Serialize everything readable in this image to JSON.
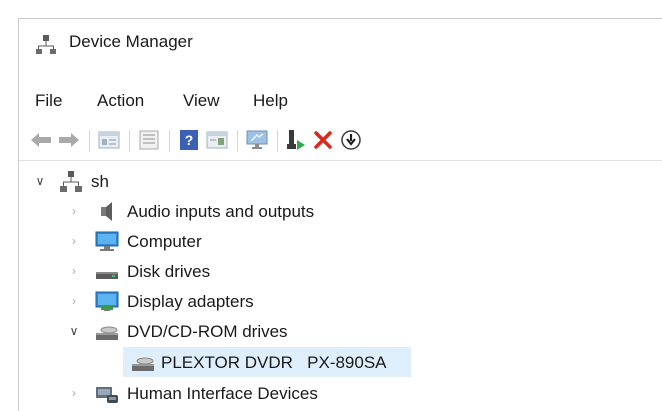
{
  "window": {
    "title": "Device Manager"
  },
  "menu": {
    "items": [
      "File",
      "Action",
      "View",
      "Help"
    ]
  },
  "toolbar": {
    "icons": [
      "back-icon",
      "forward-icon",
      "properties-pane-icon",
      "console-tree-icon",
      "help-icon",
      "action-pane-icon",
      "monitor-icon",
      "update-driver-icon",
      "uninstall-icon",
      "disable-device-icon"
    ]
  },
  "tree": {
    "root": {
      "label": "sh",
      "expanded": true
    },
    "nodes": [
      {
        "label": "Audio inputs and outputs",
        "expanded": false,
        "icon": "audio-icon"
      },
      {
        "label": "Computer",
        "expanded": false,
        "icon": "computer-icon"
      },
      {
        "label": "Disk drives",
        "expanded": false,
        "icon": "disk-drive-icon"
      },
      {
        "label": "Display adapters",
        "expanded": false,
        "icon": "display-adapter-icon"
      },
      {
        "label": "DVD/CD-ROM drives",
        "expanded": true,
        "icon": "dvd-drive-icon",
        "children": [
          {
            "label": "PLEXTOR DVDR   PX-890SA",
            "selected": true,
            "icon": "dvd-drive-icon"
          }
        ]
      },
      {
        "label": "Human Interface Devices",
        "expanded": false,
        "icon": "hid-icon"
      }
    ]
  },
  "colors": {
    "accent_red": "#e0251b",
    "selection": "#dfeefb",
    "chevron": "#a8a8a8"
  }
}
